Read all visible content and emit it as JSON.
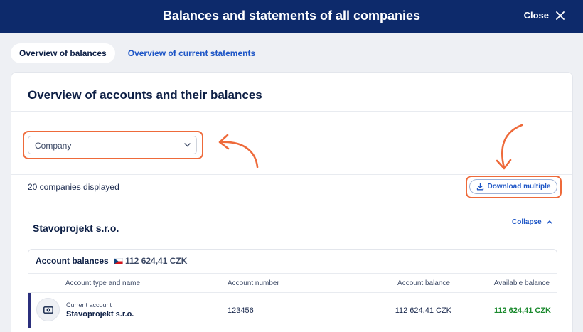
{
  "header": {
    "title": "Balances and statements of all companies",
    "close_label": "Close"
  },
  "tabs": [
    {
      "label": "Overview of balances",
      "active": true
    },
    {
      "label": "Overview of current statements",
      "active": false
    }
  ],
  "main": {
    "title": "Overview of accounts and their balances",
    "company_select": {
      "value": "Company"
    },
    "count_text": "20 companies displayed",
    "download_label": "Download multiple"
  },
  "company": {
    "name": "Stavoprojekt s.r.o.",
    "collapse_label": "Collapse",
    "balances_label": "Account balances",
    "balances_total": "112 624,41 CZK",
    "columns": {
      "type_name": "Account type and name",
      "number": "Account number",
      "balance": "Account balance",
      "available": "Available balance"
    },
    "rows": [
      {
        "type": "Current account",
        "name": "Stavoprojekt s.r.o.",
        "number": "123456",
        "balance": "112 624,41 CZK",
        "available": "112 624,41 CZK"
      }
    ]
  },
  "colors": {
    "header_bg": "#0d2a6b",
    "accent_orange": "#ee6a3a",
    "link_blue": "#1e56c6",
    "positive_green": "#1b8a2e"
  },
  "icons": [
    "close-icon",
    "chevron-down-icon",
    "download-icon",
    "chevron-up-icon",
    "czech-flag-icon",
    "banknote-icon"
  ]
}
